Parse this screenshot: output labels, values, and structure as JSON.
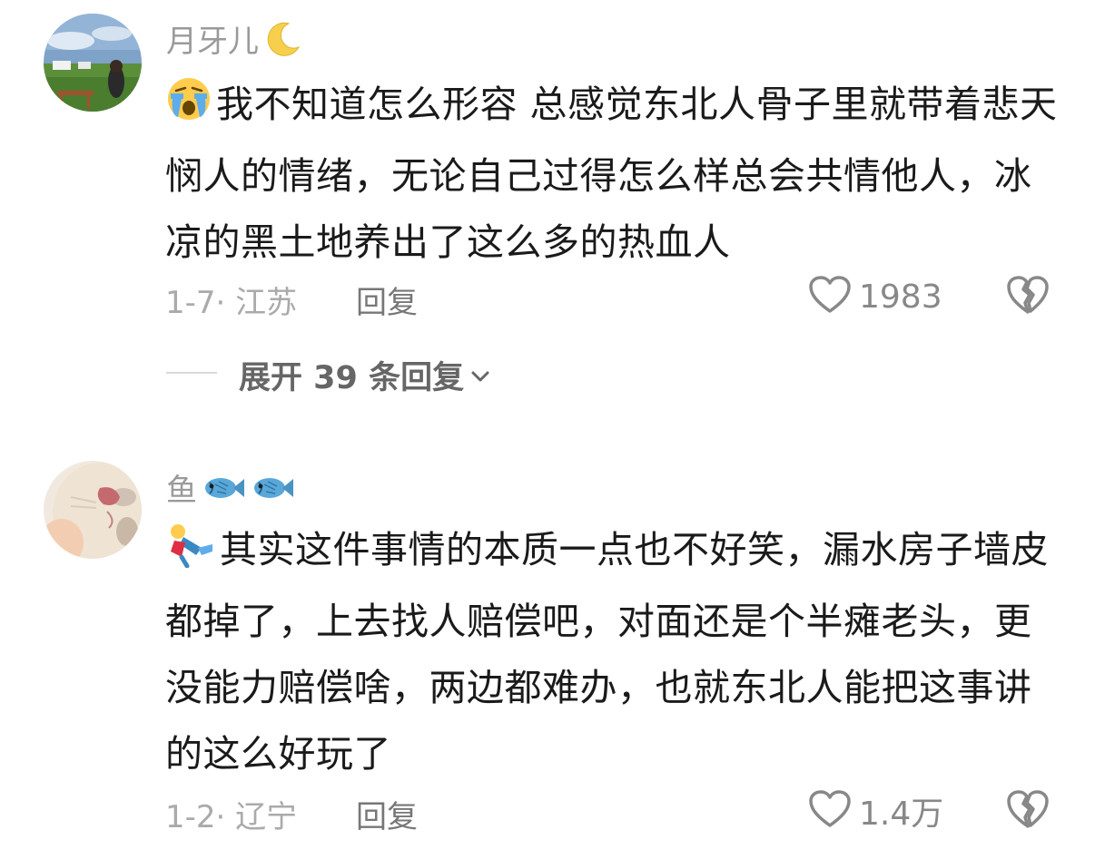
{
  "comments": [
    {
      "username": "月牙儿",
      "username_decoration": "crescent-moon-emoji",
      "text": "我不知道怎么形容 总感觉东北人骨子里就带着悲天悯人的情绪，无论自己过得怎么样总会共情他人，冰凉的黑土地养出了这么多的热血人",
      "text_prefix_emoji": "loudly-crying-face-emoji",
      "date_location": "1-7· 江苏",
      "reply_label": "回复",
      "like_count": "1983",
      "expand_label": "展开 39 条回复"
    },
    {
      "username": "鱼",
      "username_decoration": "fish-emoji x2",
      "text": "其实这件事情的本质一点也不好笑，漏水房子墙皮都掉了，上去找人赔偿吧，对面还是个半瘫老头，更没能力赔偿啥，两边都难办，也就东北人能把这事讲的这么好玩了",
      "text_prefix_emoji": "falling-person-emoji",
      "date_location": "1-2· 辽宁",
      "reply_label": "回复",
      "like_count": "1.4万"
    }
  ],
  "colors": {
    "background": "#ffffff",
    "username": "#9a9a9a",
    "body_text": "#1a1a1a",
    "meta_text": "#aaaaaa",
    "icon_gray": "#888888"
  },
  "icons": [
    "heart-outline-icon",
    "broken-heart-icon",
    "chevron-down-icon"
  ]
}
